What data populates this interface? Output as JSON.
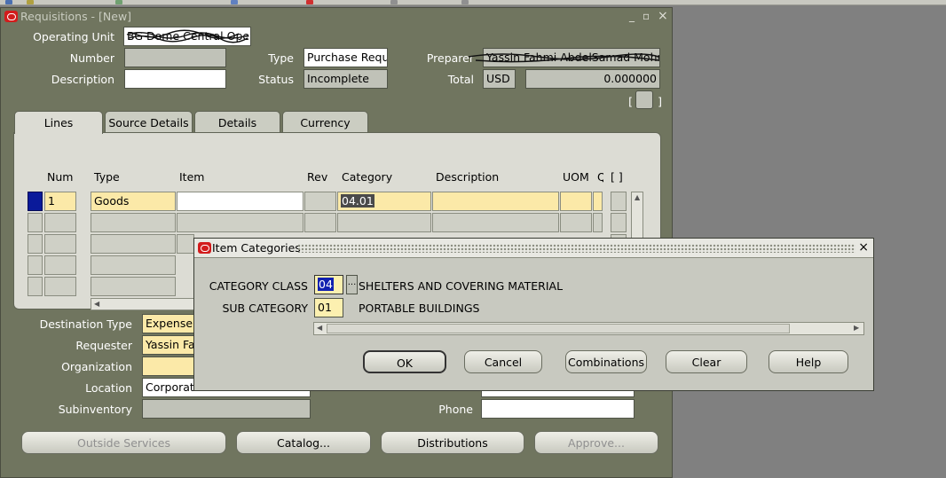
{
  "window": {
    "title": "Requisitions - [New]",
    "controls": [
      "_",
      "▫",
      "×"
    ]
  },
  "header": {
    "operating_unit_label": "Operating Unit",
    "operating_unit_value": "BG Dome Central Operat",
    "number_label": "Number",
    "number_value": "",
    "description_label": "Description",
    "description_value": "",
    "type_label": "Type",
    "type_value": "Purchase Requi",
    "status_label": "Status",
    "status_value": "Incomplete",
    "preparer_label": "Preparer",
    "preparer_value": "Yassin Fahmi AbdelSamad Mohm",
    "total_label": "Total",
    "currency_value": "USD",
    "total_value": "0.000000",
    "bracket_open": "[",
    "bracket_close": "]"
  },
  "tabs": [
    "Lines",
    "Source Details",
    "Details",
    "Currency"
  ],
  "lines": {
    "columns": {
      "num": "Num",
      "type": "Type",
      "item": "Item",
      "rev": "Rev",
      "category": "Category",
      "description": "Description",
      "uom": "UOM",
      "q": "Q",
      "flex": "[ ]"
    },
    "row1": {
      "num": "1",
      "type": "Goods",
      "item": "",
      "rev": "",
      "category": "04.01",
      "description": "",
      "uom": ""
    }
  },
  "lower": {
    "destination_type_label": "Destination Type",
    "destination_type_value": "Expense",
    "requester_label": "Requester",
    "requester_value": "Yassin Fa",
    "organization_label": "Organization",
    "organization_value": "",
    "location_label": "Location",
    "location_value": "Corporate",
    "subinventory_label": "Subinventory",
    "subinventory_value": "",
    "phone_label": "Phone",
    "phone_value": ""
  },
  "bottom_buttons": {
    "outside_services": "Outside Services",
    "catalog": "Catalog...",
    "distributions": "Distributions",
    "approve": "Approve..."
  },
  "dialog": {
    "title": "Item Categories",
    "category_class_label": "CATEGORY CLASS",
    "category_class_value": "04",
    "category_class_desc": "SHELTERS AND COVERING MATERIAL",
    "lov_button": "...",
    "sub_category_label": "SUB CATEGORY",
    "sub_category_value": "01",
    "sub_category_desc": "PORTABLE BUILDINGS",
    "buttons": {
      "ok": "OK",
      "cancel": "Cancel",
      "combinations": "Combinations",
      "clear": "Clear",
      "help": "Help"
    },
    "close": "×"
  }
}
